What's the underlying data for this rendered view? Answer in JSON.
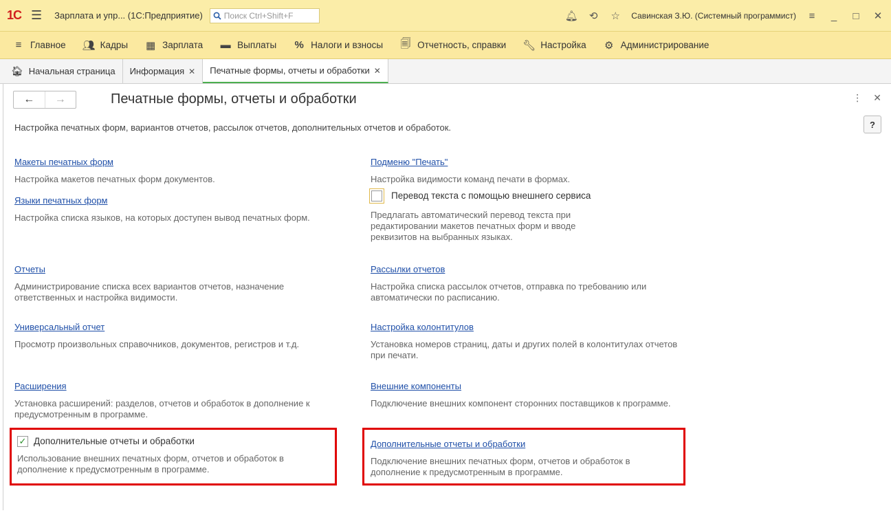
{
  "titlebar": {
    "logo": "1С",
    "app_title": "Зарплата и упр...  (1С:Предприятие)",
    "search_placeholder": "Поиск Ctrl+Shift+F",
    "user": "Савинская З.Ю. (Системный программист)"
  },
  "sections": [
    {
      "icon": "hamburger-icon",
      "label": "Главное"
    },
    {
      "icon": "people-icon",
      "label": "Кадры"
    },
    {
      "icon": "calculator-icon",
      "label": "Зарплата"
    },
    {
      "icon": "wallet-icon",
      "label": "Выплаты"
    },
    {
      "icon": "percent-icon",
      "label": "Налоги и взносы"
    },
    {
      "icon": "report-icon",
      "label": "Отчетность, справки"
    },
    {
      "icon": "wrench-icon",
      "label": "Настройка"
    },
    {
      "icon": "gear-icon",
      "label": "Администрирование"
    }
  ],
  "tabs": {
    "home": "Начальная страница",
    "info": "Информация",
    "current": "Печатные формы, отчеты и обработки"
  },
  "form": {
    "title": "Печатные формы, отчеты и обработки",
    "subtitle": "Настройка печатных форм, вариантов отчетов, рассылок отчетов, дополнительных отчетов и обработок.",
    "help": "?"
  },
  "left": {
    "i1": {
      "link": "Макеты печатных форм",
      "desc": "Настройка макетов печатных форм документов."
    },
    "i2": {
      "link": "Языки печатных форм",
      "desc": "Настройка списка языков, на которых доступен вывод печатных форм."
    },
    "i3": {
      "link": "Отчеты",
      "desc": "Администрирование списка всех вариантов отчетов, назначение ответственных и настройка видимости."
    },
    "i4": {
      "link": "Универсальный отчет",
      "desc": "Просмотр произвольных справочников, документов, регистров и т.д."
    },
    "i5": {
      "link": "Расширения",
      "desc": "Установка расширений: разделов, отчетов и обработок в дополнение к предусмотренным в программе."
    },
    "i6": {
      "checkbox": "Дополнительные отчеты и обработки",
      "desc": "Использование внешних печатных форм, отчетов и обработок в дополнение к предусмотренным в программе."
    }
  },
  "right": {
    "i1": {
      "link": "Подменю \"Печать\"",
      "desc": "Настройка видимости команд печати в формах."
    },
    "i2": {
      "checkbox": "Перевод текста с помощью внешнего сервиса",
      "desc": "Предлагать автоматический перевод текста при редактировании макетов печатных форм и вводе реквизитов на выбранных языках."
    },
    "i3": {
      "link": "Рассылки отчетов",
      "desc": "Настройка списка рассылок отчетов, отправка по требованию или автоматически по расписанию."
    },
    "i4": {
      "link": "Настройка колонтитулов",
      "desc": "Установка номеров страниц, даты и других полей в колонтитулах отчетов при печати."
    },
    "i5": {
      "link": "Внешние компоненты",
      "desc": "Подключение внешних компонент сторонних поставщиков к программе."
    },
    "i6": {
      "link": "Дополнительные отчеты и обработки",
      "desc": "Подключение внешних печатных форм, отчетов и обработок в дополнение к предусмотренным в программе."
    }
  }
}
